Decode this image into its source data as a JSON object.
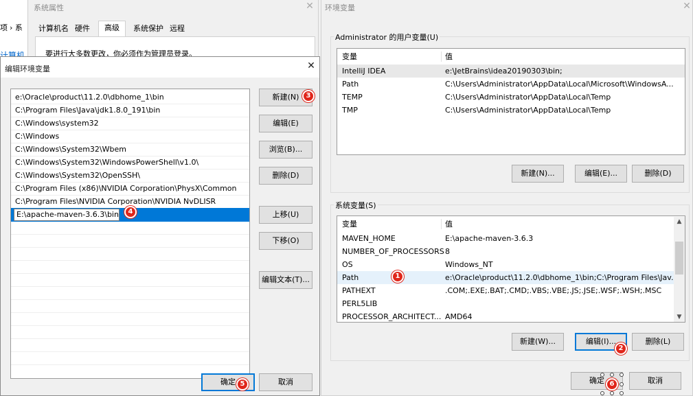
{
  "bg": {
    "sidebar_frag1": "项",
    "sidebar_frag2": "› 系",
    "sidebar_frag3": "计算机"
  },
  "sysprops": {
    "title": "系统属性",
    "tabs": [
      "计算机名",
      "硬件",
      "高级",
      "系统保护",
      "远程"
    ],
    "notice": "要进行大多数更改，你必须作为管理员登录。"
  },
  "editenv": {
    "title": "编辑环境变量",
    "paths": [
      "e:\\Oracle\\product\\11.2.0\\dbhome_1\\bin",
      "C:\\Program Files\\Java\\jdk1.8.0_191\\bin",
      "C:\\Windows\\system32",
      "C:\\Windows",
      "C:\\Windows\\System32\\Wbem",
      "C:\\Windows\\System32\\WindowsPowerShell\\v1.0\\",
      "C:\\Windows\\System32\\OpenSSH\\",
      "C:\\Program Files (x86)\\NVIDIA Corporation\\PhysX\\Common",
      "C:\\Program Files\\NVIDIA Corporation\\NVIDIA NvDLISR"
    ],
    "editing_value": "E:\\apache-maven-3.6.3\\bin",
    "buttons": {
      "new": "新建(N)",
      "edit": "编辑(E)",
      "browse": "浏览(B)...",
      "delete": "删除(D)",
      "move_up": "上移(U)",
      "move_down": "下移(O)",
      "edit_text": "编辑文本(T)...",
      "ok": "确定",
      "cancel": "取消"
    }
  },
  "envvars": {
    "title": "环境变量",
    "user_group_title": "Administrator 的用户变量(U)",
    "col_var": "变量",
    "col_val": "值",
    "user_vars": [
      {
        "name": "IntelliJ IDEA",
        "value": "e:\\JetBrains\\idea20190303\\bin;"
      },
      {
        "name": "Path",
        "value": "C:\\Users\\Administrator\\AppData\\Local\\Microsoft\\WindowsA..."
      },
      {
        "name": "TEMP",
        "value": "C:\\Users\\Administrator\\AppData\\Local\\Temp"
      },
      {
        "name": "TMP",
        "value": "C:\\Users\\Administrator\\AppData\\Local\\Temp"
      }
    ],
    "user_buttons": {
      "new": "新建(N)...",
      "edit": "编辑(E)...",
      "delete": "删除(D)"
    },
    "sys_group_title": "系统变量(S)",
    "sys_vars": [
      {
        "name": "MAVEN_HOME",
        "value": "E:\\apache-maven-3.6.3"
      },
      {
        "name": "NUMBER_OF_PROCESSORS",
        "value": "8"
      },
      {
        "name": "OS",
        "value": "Windows_NT"
      },
      {
        "name": "Path",
        "value": "e:\\Oracle\\product\\11.2.0\\dbhome_1\\bin;C:\\Program Files\\Jav..."
      },
      {
        "name": "PATHEXT",
        "value": ".COM;.EXE;.BAT;.CMD;.VBS;.VBE;.JS;.JSE;.WSF;.WSH;.MSC"
      },
      {
        "name": "PERL5LIB",
        "value": ""
      },
      {
        "name": "PROCESSOR_ARCHITECT...",
        "value": "AMD64"
      }
    ],
    "sys_buttons": {
      "new": "新建(W)...",
      "edit": "编辑(I)...",
      "delete": "删除(L)"
    },
    "ok": "确定",
    "cancel": "取消"
  },
  "badges": [
    "1",
    "2",
    "3",
    "4",
    "5",
    "6"
  ],
  "colors": {
    "badge": "#e0261b",
    "selection": "#0078d7"
  }
}
